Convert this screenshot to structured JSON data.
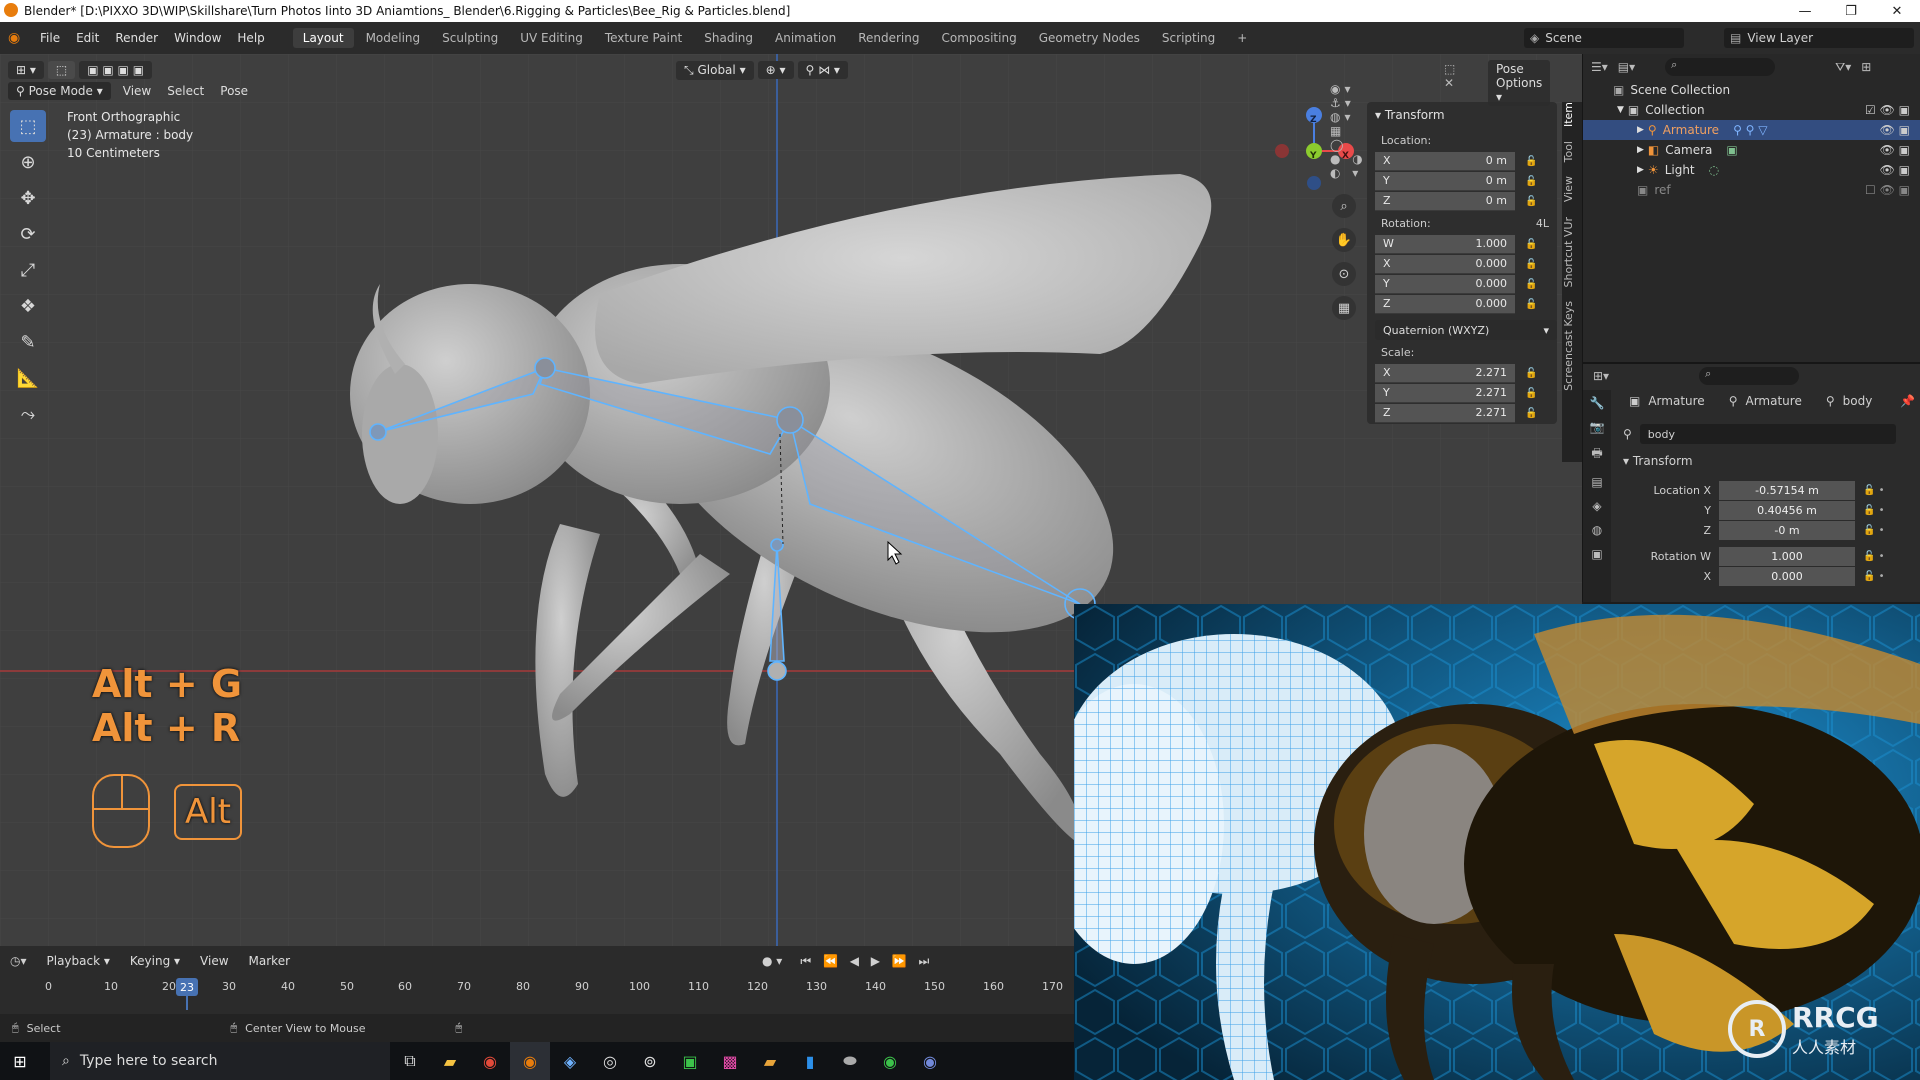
{
  "window": {
    "title": "Blender* [D:\\PIXXO 3D\\WIP\\Skillshare\\Turn Photos Iinto 3D Aniamtions_ Blender\\6.Rigging & Particles\\Bee_Rig & Particles.blend]",
    "minimize": "—",
    "maximize": "❐",
    "close": "✕"
  },
  "menu": {
    "items": [
      "File",
      "Edit",
      "Render",
      "Window",
      "Help"
    ],
    "workspaces": [
      "Layout",
      "Modeling",
      "Sculpting",
      "UV Editing",
      "Texture Paint",
      "Shading",
      "Animation",
      "Rendering",
      "Compositing",
      "Geometry Nodes",
      "Scripting"
    ],
    "add_tab": "+",
    "scene_label": "Scene",
    "view_layer_label": "View Layer"
  },
  "viewport": {
    "mode": "Pose Mode",
    "view_menu": "View",
    "select_menu": "Select",
    "pose_menu": "Pose",
    "transform_orientation": "Global",
    "pose_options": "Pose Options",
    "info_line1": "Front Orthographic",
    "info_line2": "(23) Armature : body",
    "info_line3": "10 Centimeters",
    "shortcut_line1": "Alt + G",
    "shortcut_line2": "Alt + R",
    "key_badge": "Alt"
  },
  "gizmo": {
    "z": "Z",
    "y": "Y",
    "x": "X"
  },
  "npanel": {
    "header": "Transform",
    "location_label": "Location:",
    "location": [
      {
        "axis": "X",
        "value": "0 m"
      },
      {
        "axis": "Y",
        "value": "0 m"
      },
      {
        "axis": "Z",
        "value": "0 m"
      }
    ],
    "rotation_label": "Rotation:",
    "rotation_mode_short": "4L",
    "rotation": [
      {
        "axis": "W",
        "value": "1.000"
      },
      {
        "axis": "X",
        "value": "0.000"
      },
      {
        "axis": "Y",
        "value": "0.000"
      },
      {
        "axis": "Z",
        "value": "0.000"
      }
    ],
    "rotation_mode": "Quaternion (WXYZ)",
    "scale_label": "Scale:",
    "scale": [
      {
        "axis": "X",
        "value": "2.271"
      },
      {
        "axis": "Y",
        "value": "2.271"
      },
      {
        "axis": "Z",
        "value": "2.271"
      }
    ],
    "tabs": [
      "Item",
      "Tool",
      "View",
      "Shortcut VUr",
      "Screencast Keys"
    ]
  },
  "outliner": {
    "root": "Scene Collection",
    "collection": "Collection",
    "items": [
      "Armature",
      "Camera",
      "Light"
    ],
    "ref": "ref"
  },
  "properties": {
    "breadcrumb": [
      "Armature",
      "Armature",
      "body"
    ],
    "bone_name": "body",
    "section": "Transform",
    "location_x_label": "Location X",
    "location_x": "-0.57154 m",
    "y_label": "Y",
    "location_y": "0.40456 m",
    "z_label": "Z",
    "location_z": "-0 m",
    "rotation_w_label": "Rotation W",
    "rotation_w": "1.000",
    "x_label": "X",
    "rotation_x": "0.000"
  },
  "timeline": {
    "playback": "Playback",
    "keying": "Keying",
    "view": "View",
    "marker": "Marker",
    "frames": [
      "0",
      "10",
      "20",
      "30",
      "40",
      "50",
      "60",
      "70",
      "80",
      "90",
      "100",
      "110",
      "120",
      "130",
      "140",
      "150",
      "160",
      "170"
    ],
    "current_frame": "23"
  },
  "statusbar": {
    "select": "Select",
    "center_view": "Center View to Mouse"
  },
  "taskbar": {
    "search_placeholder": "Type here to search"
  },
  "watermark": {
    "brand": "RRCG",
    "cn": "人人素材"
  },
  "colors": {
    "accent": "#4772b3",
    "orange_key": "#f0943a",
    "bone_outline": "#5fb4ff",
    "x_axis": "#e84a4a",
    "y_axis": "#8ccc2e",
    "z_axis": "#4a7fe0"
  }
}
